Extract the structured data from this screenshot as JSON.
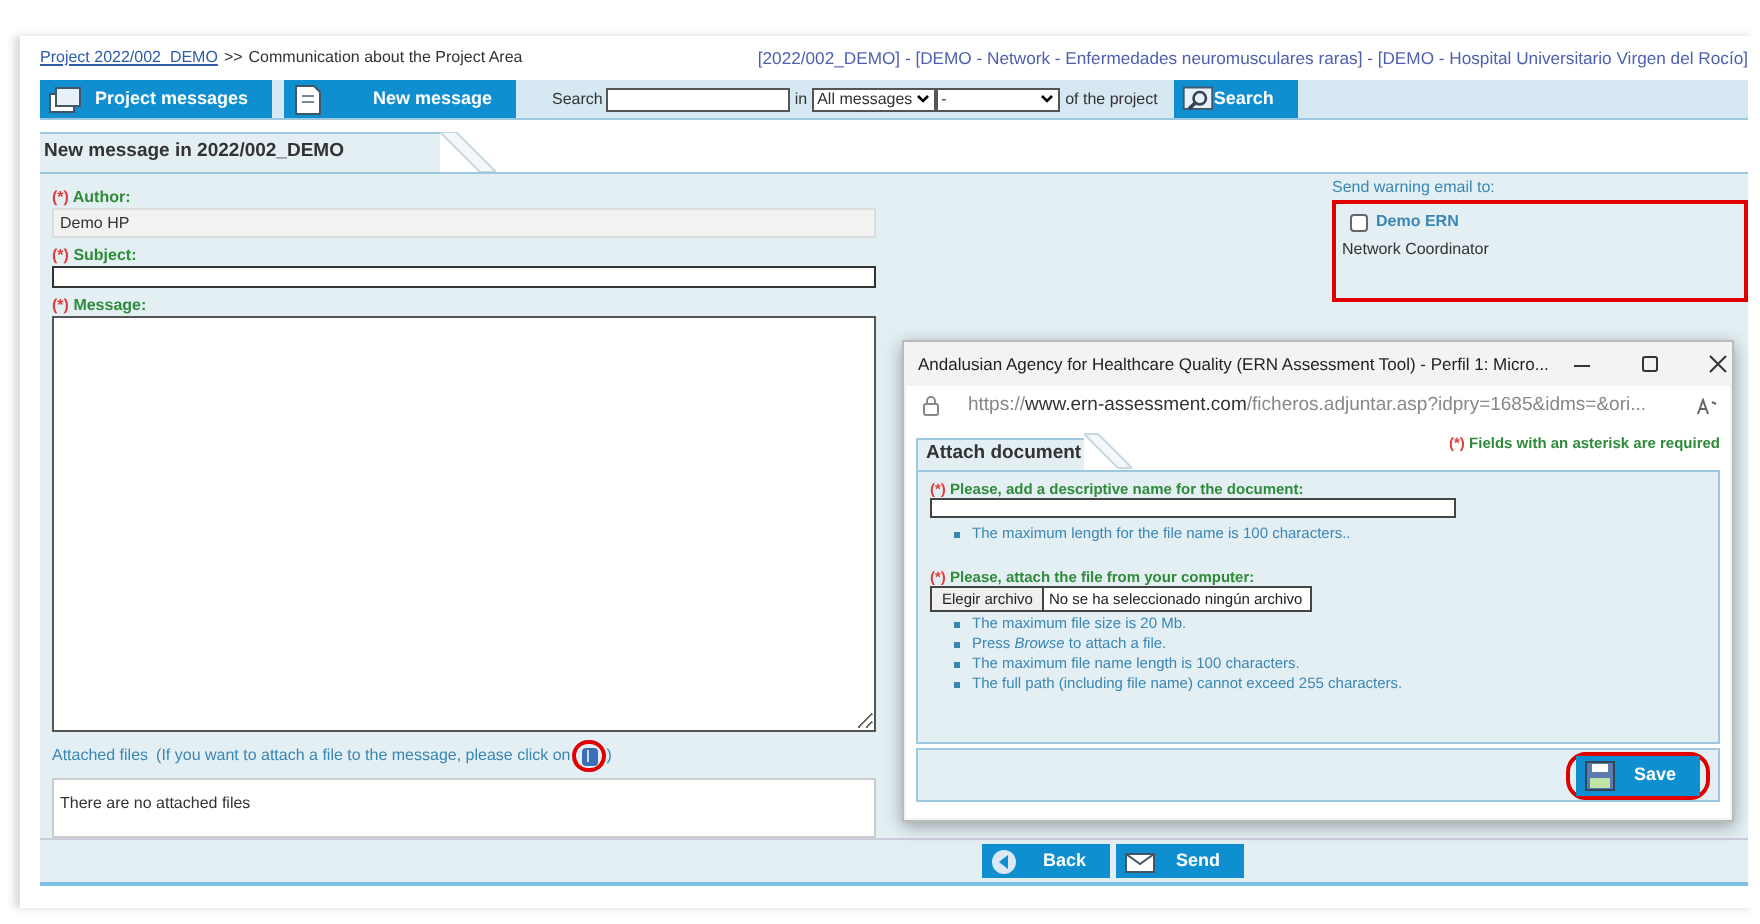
{
  "breadcrumb": {
    "link": "Project 2022/002_DEMO",
    "separator": ">>",
    "current": "Communication about the Project Area"
  },
  "project_info": "[2022/002_DEMO] - [DEMO - Network - Enfermedades neuromusculares raras] - [DEMO - Hospital Universitario Virgen del Rocío]",
  "toolbar": {
    "buttons": [
      {
        "label": "Project messages",
        "kind": "messages"
      },
      {
        "label": "New message",
        "kind": "new"
      }
    ],
    "search_label": "Search",
    "in_label": "in",
    "scope_select": "All messages",
    "filter_select": "-",
    "suffix": "of the project",
    "search_button": "Search"
  },
  "form": {
    "tab": "New message in 2022/002_DEMO",
    "fields": [
      {
        "marker": "(*)",
        "label": "Author:",
        "kind": "readonly",
        "value": "Demo HP"
      },
      {
        "marker": "(*)",
        "label": "Subject:",
        "kind": "text"
      },
      {
        "marker": "(*)",
        "label": "Message:",
        "kind": "textarea"
      }
    ],
    "attached_label": "Attached files",
    "attached_hint": "(If you want to attach a file to the message, please click on",
    "attached_hint_end": ")",
    "attach_icon_highlighted": true,
    "attached_empty": "There are no attached files",
    "buttons": [
      {
        "label": "Back",
        "kind": "back"
      },
      {
        "label": "Send",
        "kind": "send"
      }
    ]
  },
  "warning": {
    "title": "Send warning email to:",
    "highlighted": true,
    "recipients": [
      {
        "name": "Demo ERN",
        "role": "Network Coordinator",
        "checked": false
      }
    ]
  },
  "popup": {
    "title": "Andalusian Agency for Healthcare Quality (ERN Assessment Tool) - Perfil 1: Micro...",
    "url_scheme": "https://",
    "url_domain": "www.ern-assessment.com",
    "url_path": "/ficheros.adjuntar.asp?idpry=1685&idms=&ori...",
    "tab": "Attach document",
    "required_marker": "(*)",
    "required_note": "Fields with an asterisk are required",
    "name_marker": "(*)",
    "name_label": "Please, add a descriptive name for the document:",
    "name_hints": [
      "The maximum length for the file name is 100 characters.."
    ],
    "file_marker": "(*)",
    "file_label": "Please, attach the file from your computer:",
    "file_button": "Elegir archivo",
    "file_status": "No se ha seleccionado ningún archivo",
    "file_hints": [
      "The maximum file size is 20 Mb.",
      "Press *Browse* to attach a file.",
      "The maximum file name length is 100 characters.",
      "The full path (including file name) cannot exceed 255 characters."
    ],
    "save_button": "Save",
    "save_highlighted": true
  }
}
